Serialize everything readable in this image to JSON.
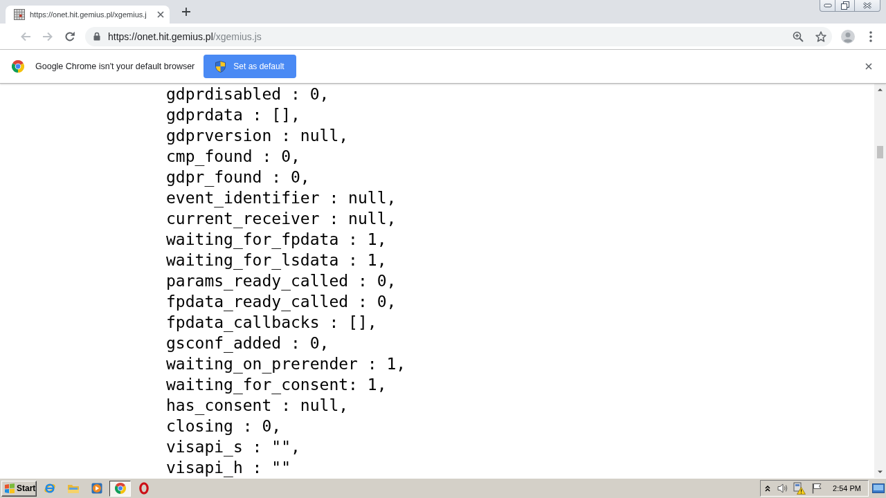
{
  "tabs": [
    {
      "title": "https://onet.hit.gemius.pl/xgemius.j",
      "selected": true
    }
  ],
  "toolbar": {
    "navigation": [
      {
        "kind": "back",
        "disabled": true
      },
      {
        "kind": "forward",
        "disabled": true
      },
      {
        "kind": "reload",
        "disabled": false
      }
    ],
    "url": {
      "host": "https://onet.hit.gemius.pl",
      "path": "/xgemius.js"
    }
  },
  "infobar": {
    "message": "Google Chrome isn't your default browser",
    "button": "Set as default"
  },
  "code_lines": [
    "gdprdisabled : 0,",
    "gdprdata : [],",
    "gdprversion : null,",
    "cmp_found : 0,",
    "gdpr_found : 0,",
    "event_identifier : null,",
    "current_receiver : null,",
    "waiting_for_fpdata : 1,",
    "waiting_for_lsdata : 1,",
    "params_ready_called : 0,",
    "fpdata_ready_called : 0,",
    "fpdata_callbacks : [],",
    "gsconf_added : 0,",
    "waiting_on_prerender : 1,",
    "waiting_for_consent: 1,",
    "has_consent : null,",
    "closing : 0,",
    "visapi_s : \"\",",
    "visapi_h : \"\""
  ],
  "taskbar": {
    "start": "Start",
    "apps": [
      {
        "kind": "ie",
        "selected": false
      },
      {
        "kind": "explorer",
        "selected": false
      },
      {
        "kind": "media",
        "selected": false
      },
      {
        "kind": "chrome",
        "selected": true
      },
      {
        "kind": "opera",
        "selected": false
      }
    ],
    "clock": "2:54 PM"
  }
}
